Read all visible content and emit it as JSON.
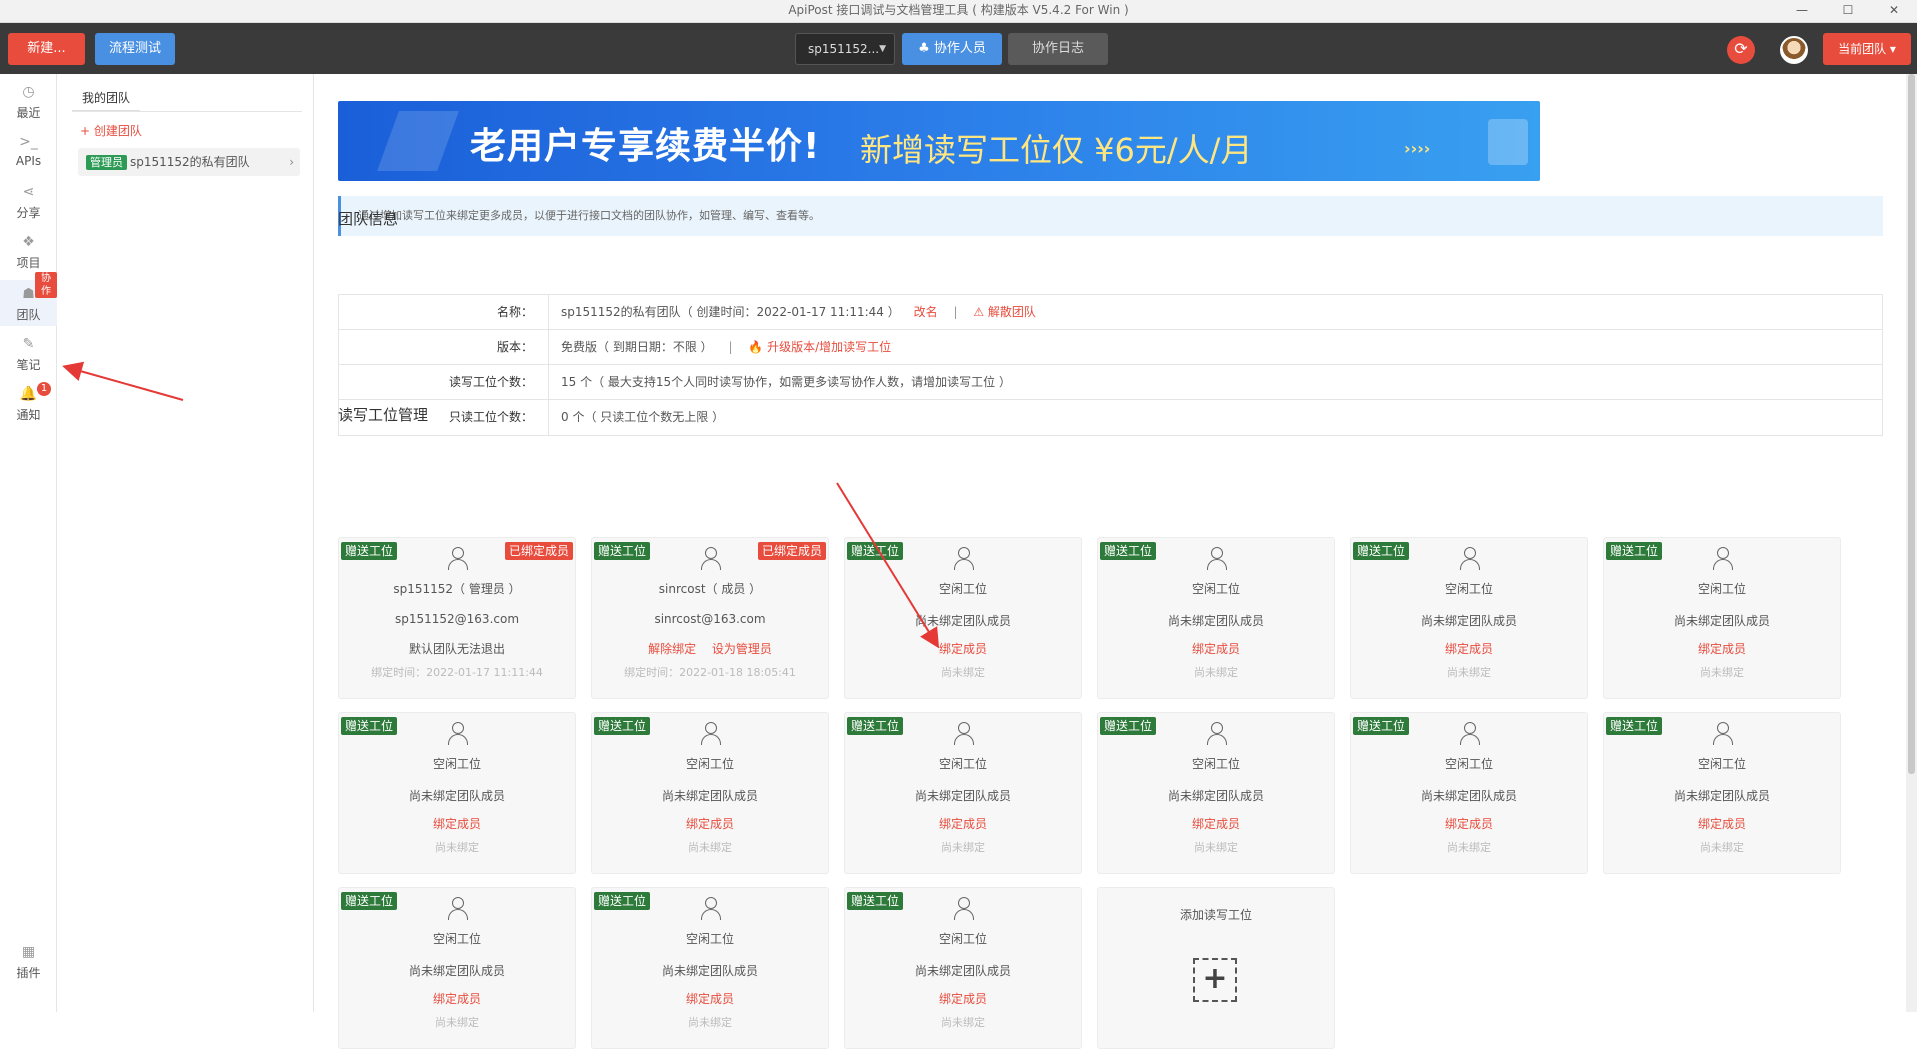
{
  "window": {
    "title": "ApiPost 接口调试与文档管理工具 ( 构建版本 V5.4.2 For Win )"
  },
  "toolbar": {
    "new_label": "新建...",
    "flow_label": "流程测试",
    "team_select": "sp151152...",
    "collab_label": "协作人员",
    "log_label": "协作日志",
    "current_team_label": "当前团队"
  },
  "rail": {
    "recent": "最近",
    "apis": "APIs",
    "share": "分享",
    "project": "项目",
    "team": "团队",
    "team_tag": "协作",
    "notes": "笔记",
    "notify": "通知",
    "notify_count": "1",
    "plugins": "插件"
  },
  "team_panel": {
    "tab": "我的团队",
    "create": "+ 创建团队",
    "admin_tag": "管理员",
    "team_name": "sp151152的私有团队"
  },
  "banner": {
    "text1": "老用户专享续费半价!",
    "text2": "新增读写工位仅 ¥6元/人/月",
    "arrows": "››››"
  },
  "notice": "通过增加读写工位来绑定更多成员，以便于进行接口文档的团队协作，如管理、编写、查看等。",
  "team_info": {
    "title": "团队信息",
    "rows": [
      {
        "label": "名称：",
        "value": "sp151152的私有团队（ 创建时间：2022-01-17 11:11:44 ）",
        "link1": "改名",
        "link2": "⚠ 解散团队"
      },
      {
        "label": "版本：",
        "value": "免费版（ 到期日期：不限 ）",
        "link1": "🔥 升级版本/增加读写工位",
        "link2": ""
      },
      {
        "label": "读写工位个数：",
        "value": "15 个（ 最大支持15个人同时读写协作，如需更多读写协作人数，请增加读写工位 ）",
        "link1": "",
        "link2": ""
      },
      {
        "label": "只读工位个数：",
        "value": "0 个（ 只读工位个数无上限 ）",
        "link1": "",
        "link2": ""
      }
    ]
  },
  "seats_title": "读写工位管理",
  "seat_common": {
    "gift": "赠送工位",
    "bound": "已绑定成员",
    "idle": "空闲工位",
    "unbound_member": "尚未绑定团队成员",
    "bind": "绑定成员",
    "not_bound": "尚未绑定",
    "add": "添加读写工位",
    "plus": "+"
  },
  "seats": [
    {
      "name": "sp151152（ 管理员 ）",
      "email": "sp151152@163.com",
      "note": "默认团队无法退出",
      "time": "绑定时间：2022-01-17 11:11:44"
    },
    {
      "name": "sinrcost（ 成员 ）",
      "email": "sinrcost@163.com",
      "action1": "解除绑定",
      "action2": "设为管理员",
      "time": "绑定时间：2022-01-18 18:05:41"
    }
  ],
  "colors": {
    "accent_red": "#e84c3d",
    "accent_blue": "#4a90e2",
    "gift_green": "#2d7a3a",
    "toolbar_bg": "#3a3a3a"
  }
}
